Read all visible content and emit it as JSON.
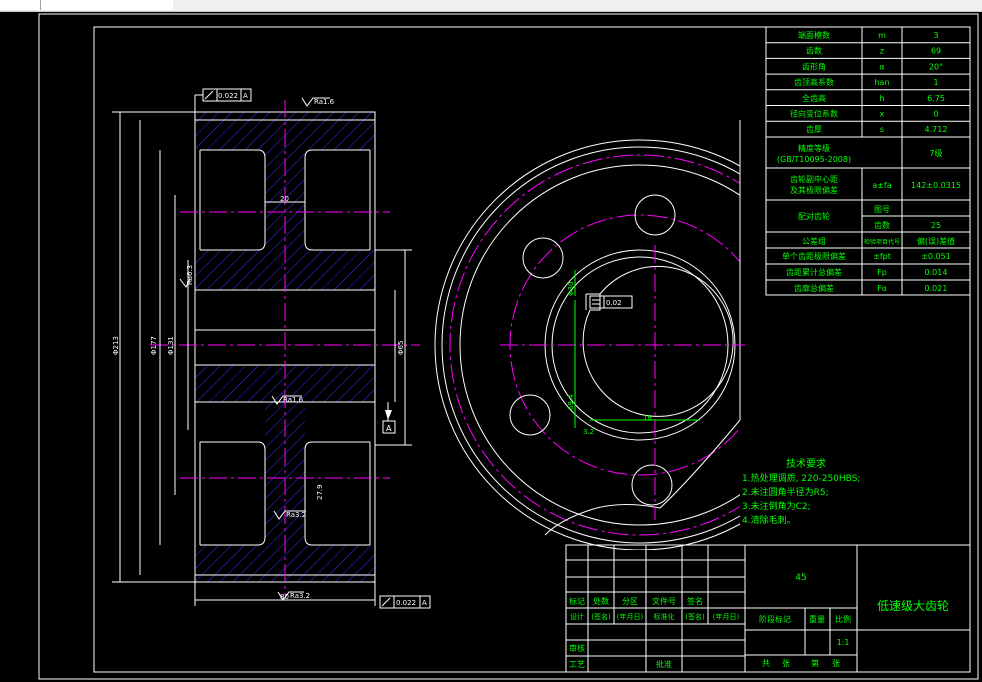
{
  "params_table": [
    {
      "name": "端面模数",
      "sym": "m",
      "val": "3"
    },
    {
      "name": "齿数",
      "sym": "z",
      "val": "69"
    },
    {
      "name": "齿形角",
      "sym": "α",
      "val": "20°"
    },
    {
      "name": "齿顶高系数",
      "sym": "han",
      "val": "1"
    },
    {
      "name": "全齿高",
      "sym": "h",
      "val": "6.75"
    },
    {
      "name": "径向变位系数",
      "sym": "x",
      "val": "0"
    },
    {
      "name": "齿厚",
      "sym": "s",
      "val": "4.712"
    }
  ],
  "precision": {
    "label_line1": "精度等级",
    "label_line2": "(GB/T10095-2008)",
    "value": "7级"
  },
  "center_distance": {
    "label_line1": "齿轮副中心距",
    "label_line2": "及其极限偏差",
    "sym": "a±fa",
    "value": "142±0.0315"
  },
  "mating_gear": {
    "label": "配对齿轮",
    "rows": [
      {
        "name": "图号",
        "value": ""
      },
      {
        "name": "齿数",
        "value": "25"
      }
    ]
  },
  "tolerance_header": {
    "label": "公差组",
    "sym": "检验项目代号",
    "value": "偏(误)差值"
  },
  "tolerance_rows": [
    {
      "name": "单个齿距极限偏差",
      "sym": "±fpt",
      "val": "±0.051"
    },
    {
      "name": "齿距累计总偏差",
      "sym": "Fp",
      "val": "0.014"
    },
    {
      "name": "齿廓总偏差",
      "sym": "Fα",
      "val": "0.021"
    }
  ],
  "tech_requirements": {
    "title": "技术要求",
    "items": [
      "1.热处理调质, 220-250HBS;",
      "2.未注圆角半径为R5;",
      "3.未注倒角为C2;",
      "4.清除毛刺。"
    ]
  },
  "title_block": {
    "material": "45",
    "part_name": "低速级大齿轮",
    "header_labels": [
      "标记",
      "处数",
      "分区",
      "文件号",
      "签名"
    ],
    "design_row": [
      "设计",
      "(签名)",
      "(年月日)",
      "标准化",
      "(签名)",
      "(年月日)"
    ],
    "review": "审核",
    "process": "工艺",
    "approve": "批准",
    "stage_label": "阶段标记",
    "weight_label": "重量",
    "scale_label": "比例",
    "scale_value": "1:1",
    "sheets": [
      "共",
      "张",
      "第",
      "张"
    ]
  },
  "dimensions": {
    "da": "Φ213",
    "d_outer_web": "Φ177",
    "d_hub": "Φ131",
    "d_bore": "Φ65",
    "width": "80",
    "web_thickness": "20",
    "holes": "Φ30",
    "keyway_width": "18",
    "keyway_depth": "69.4",
    "slot_dim": "27.9",
    "roughness_1": "Ra1.6",
    "roughness_2": "Ra3.2",
    "roughness_3": "Ra1.6",
    "roughness_4": "Ra6.3",
    "roughness_5": "Ra3.2",
    "runout_1": "0.022",
    "runout_2": "0.022",
    "parallel": "0.02",
    "datum": "A",
    "chamfer": "3.2"
  },
  "colors": {
    "outline": "#ffffff",
    "text": "#00ff00",
    "center": "#ff00ff",
    "hatch": "#3030ff",
    "bg": "#000000"
  }
}
